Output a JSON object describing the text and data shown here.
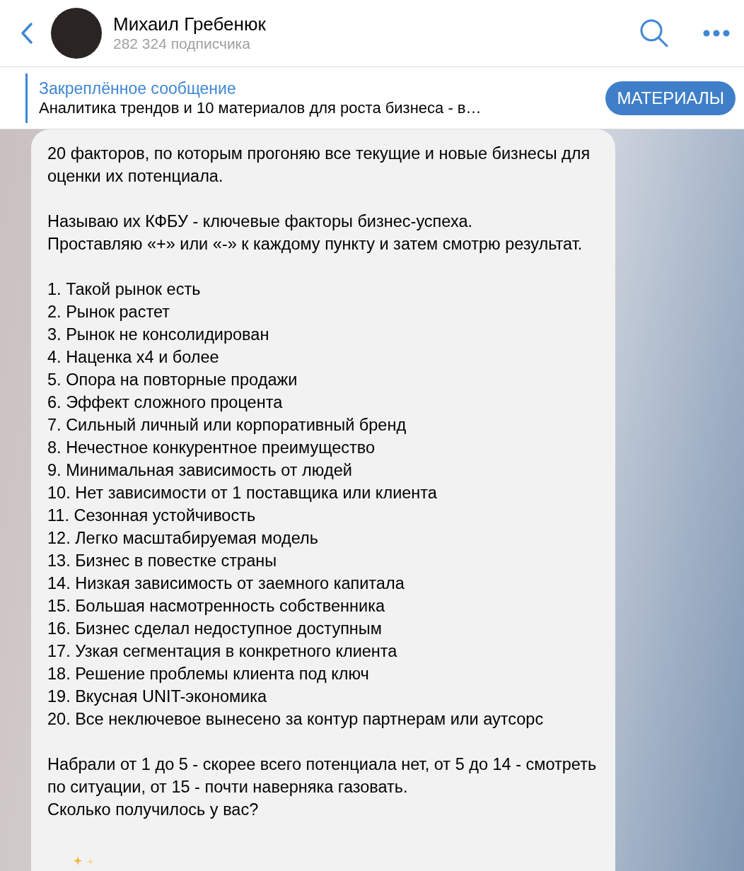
{
  "header": {
    "name": "Михаил Гребенюк",
    "subtitle": "282 324 подписчика"
  },
  "pinned": {
    "title": "Закреплённое сообщение",
    "text": "Аналитика трендов и 10 материалов для роста бизнеса - в…",
    "button": "МАТЕРИАЛЫ"
  },
  "message": {
    "blocks": [
      [
        "20 факторов, по которым прогоняю все текущие и новые бизнесы для оценки их потенциала."
      ],
      [
        "Называю их КФБУ - ключевые факторы бизнес-успеха.",
        "Проставляю «+» или «-» к каждому пункту и затем смотрю результат."
      ],
      [
        "1. Такой рынок есть",
        "2. Рынок растет",
        "3. Рынок не консолидирован",
        "4. Наценка x4 и более",
        "5. Опора на повторные продажи",
        "6. Эффект сложного процента",
        "7. Сильный личный или корпоративный бренд",
        "8. Нечестное конкурентное преимущество",
        "9. Минимальная зависимость от людей",
        "10. Нет зависимости от 1 поставщика или клиента",
        "11. Сезонная устойчивость",
        "12. Легко масштабируемая модель",
        "13. Бизнес в повестке страны",
        "14. Низкая зависимость от заемного капитала",
        "15. Большая насмотренность собственника",
        "16. Бизнес сделал недоступное доступным",
        "17. Узкая сегментация в конкретного клиента",
        "18. Решение проблемы клиента под ключ",
        "19. Вкусная UNIT-экономика",
        "20. Все неключевое вынесено за контур партнерам или аутсорс"
      ],
      [
        "Набрали от 1 до 5 - скорее всего потенциала нет, от 5 до 14 - смотреть по ситуации, от 15 - почти наверняка газовать.",
        "Сколько получилось у вас?"
      ]
    ]
  }
}
